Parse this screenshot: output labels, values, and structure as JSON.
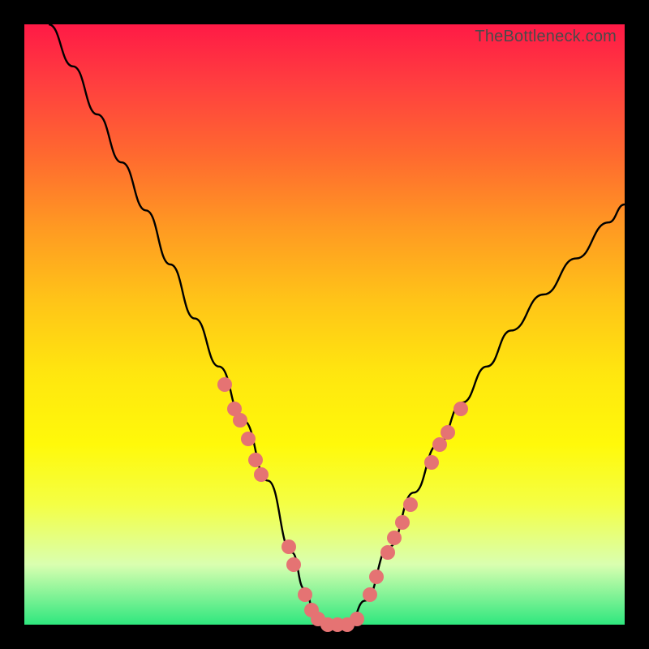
{
  "watermark_text": "TheBottleneck.com",
  "chart_data": {
    "type": "line",
    "title": "",
    "xlabel": "",
    "ylabel": "",
    "xlim": [
      0,
      740
    ],
    "ylim_value": [
      0,
      100
    ],
    "series": [
      {
        "name": "bottleneck-curve",
        "x": [
          30,
          60,
          90,
          120,
          150,
          180,
          210,
          240,
          270,
          300,
          330,
          345,
          360,
          380,
          400,
          420,
          450,
          480,
          510,
          540,
          570,
          600,
          640,
          680,
          720,
          740
        ],
        "values": [
          100,
          93,
          85,
          77,
          69,
          60,
          51,
          43,
          34,
          24,
          12,
          6,
          1,
          0,
          0,
          4,
          13,
          22,
          30,
          37,
          43,
          49,
          55,
          61,
          67,
          70
        ]
      }
    ],
    "markers": {
      "name": "highlighted-points",
      "points": [
        {
          "x": 247,
          "value": 40
        },
        {
          "x": 259,
          "value": 36
        },
        {
          "x": 266,
          "value": 34
        },
        {
          "x": 276,
          "value": 31
        },
        {
          "x": 285,
          "value": 27.5
        },
        {
          "x": 292,
          "value": 25
        },
        {
          "x": 326,
          "value": 13
        },
        {
          "x": 332,
          "value": 10
        },
        {
          "x": 346,
          "value": 5
        },
        {
          "x": 354,
          "value": 2.5
        },
        {
          "x": 362,
          "value": 1
        },
        {
          "x": 374,
          "value": 0
        },
        {
          "x": 386,
          "value": 0
        },
        {
          "x": 398,
          "value": 0
        },
        {
          "x": 410,
          "value": 1
        },
        {
          "x": 426,
          "value": 5
        },
        {
          "x": 434,
          "value": 8
        },
        {
          "x": 448,
          "value": 12
        },
        {
          "x": 456,
          "value": 14.5
        },
        {
          "x": 466,
          "value": 17
        },
        {
          "x": 476,
          "value": 20
        },
        {
          "x": 502,
          "value": 27
        },
        {
          "x": 512,
          "value": 30
        },
        {
          "x": 522,
          "value": 32
        },
        {
          "x": 538,
          "value": 36
        }
      ]
    },
    "colors": {
      "curve": "#000000",
      "marker_fill": "#e57373",
      "gradient_top": "#ff1a46",
      "gradient_bottom": "#2fe77e"
    }
  }
}
